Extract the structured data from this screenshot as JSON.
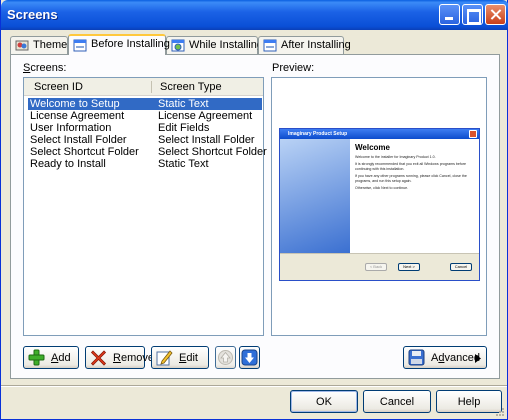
{
  "window": {
    "title": "Screens"
  },
  "tabs": [
    {
      "label": "Theme",
      "icon": "theme-icon",
      "active": false
    },
    {
      "label": "Before Installing",
      "icon": "window-icon",
      "active": true
    },
    {
      "label": "While Installing",
      "icon": "progress-window-icon",
      "active": false
    },
    {
      "label": "After Installing",
      "icon": "window-icon",
      "active": false
    }
  ],
  "screens": {
    "label_prefix": "",
    "label_accel": "S",
    "label_rest": "creens:",
    "columns": [
      "Screen ID",
      "Screen Type"
    ],
    "rows": [
      {
        "id": "Welcome to Setup",
        "type": "Static Text",
        "selected": true
      },
      {
        "id": "License Agreement",
        "type": "License Agreement",
        "selected": false
      },
      {
        "id": "User Information",
        "type": "Edit Fields",
        "selected": false
      },
      {
        "id": "Select Install Folder",
        "type": "Select Install Folder",
        "selected": false
      },
      {
        "id": "Select Shortcut Folder",
        "type": "Select Shortcut Folder",
        "selected": false
      },
      {
        "id": "Ready to Install",
        "type": "Static Text",
        "selected": false
      }
    ]
  },
  "preview": {
    "label": "Preview:",
    "window_title": "Imaginary Product Setup",
    "heading": "Welcome",
    "paragraphs": [
      "Welcome to the installer for Imaginary Product 1.0.",
      "It is strongly recommended that you exit all Windows programs before continuing with this installation.",
      "If you have any other programs running, please click Cancel, close the programs, and run this setup again.",
      "Otherwise, click Next to continue."
    ],
    "buttons": {
      "back": "< Back",
      "next": "Next >",
      "cancel": "Cancel"
    }
  },
  "actions": {
    "add": {
      "accel": "A",
      "rest": "dd"
    },
    "remove": {
      "accel": "R",
      "rest": "emove"
    },
    "edit": {
      "accel": "E",
      "rest": "dit"
    },
    "advanced": {
      "pre": "A",
      "accel": "d",
      "rest": "vanced"
    }
  },
  "dialog": {
    "ok": "OK",
    "cancel": "Cancel",
    "help": "Help"
  },
  "colors": {
    "selection": "#316ac5",
    "title_bar": "#0a4fd6",
    "tab_highlight": "#ffc83c"
  }
}
